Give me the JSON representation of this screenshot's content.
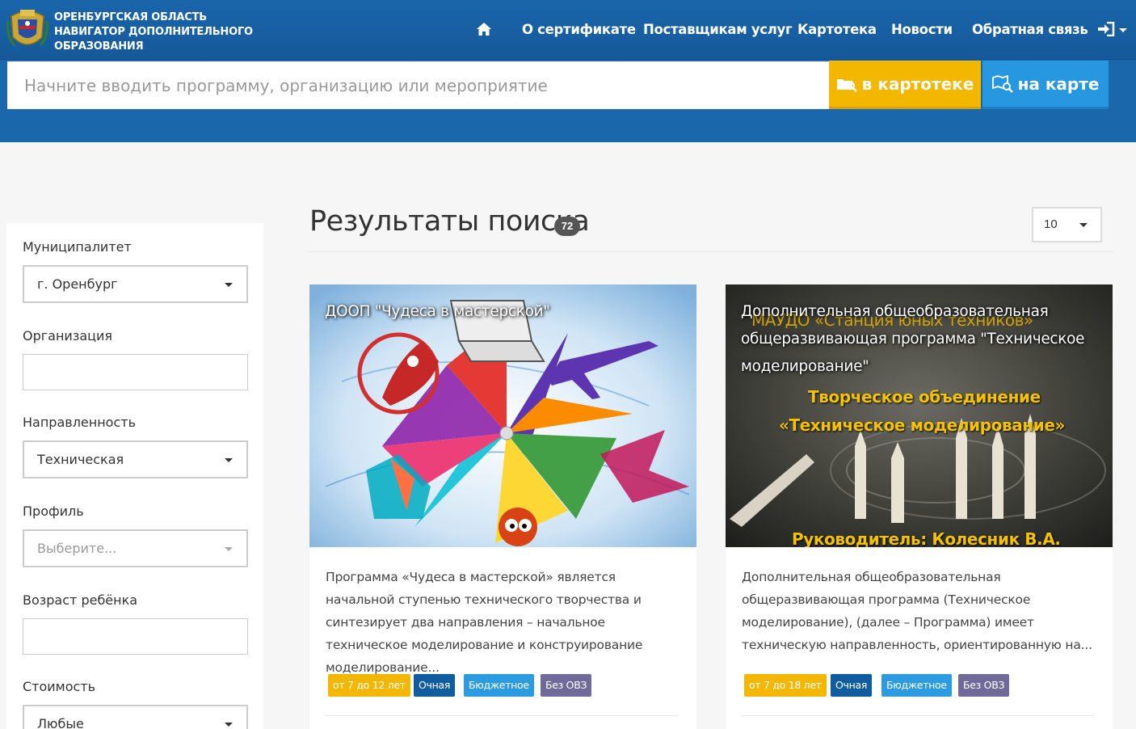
{
  "header": {
    "brand_line1": "Оренбургская область",
    "brand_line2": "Навигатор дополнительного",
    "brand_line3": "образования",
    "nav": [
      {
        "label": "О сертификате"
      },
      {
        "label": "Поставщикам услуг"
      },
      {
        "label": "Картотека"
      },
      {
        "label": "Новости"
      },
      {
        "label": "Обратная связь"
      }
    ],
    "icons": {
      "home": "home-icon",
      "login": "sign-in-icon"
    }
  },
  "search": {
    "placeholder": "Начните вводить программу, организацию или мероприятие",
    "btn_catalog": "в картотеке",
    "btn_map": "на карте"
  },
  "filters": {
    "municipality_label": "Муниципалитет",
    "municipality_value": "г. Оренбург",
    "organization_label": "Организация",
    "organization_value": "",
    "direction_label": "Направленность",
    "direction_value": "Техническая",
    "profile_label": "Профиль",
    "profile_placeholder": "Выберите...",
    "age_label": "Возраст ребёнка",
    "age_value": "",
    "cost_label": "Стоимость",
    "cost_value": "Любые"
  },
  "results": {
    "title": "Результаты поиска",
    "count": "72",
    "per_page": "10"
  },
  "cards": [
    {
      "title": "ДООП \"Чудеса в мастерской\"",
      "description": "Программа «Чудеса в мастерской» является начальной ступенью технического творчества и синтезирует два направления – начальное техническое моделирование и конструирование моделирование...",
      "tags": {
        "age": "от 7 до 12 лет",
        "form": "Очная",
        "funding": "Бюджетное",
        "ovz": "Без ОВЗ"
      }
    },
    {
      "title": "Дополнительная общеобразовательная общеразвивающая программа \"Техническое моделирование\"",
      "image_text_top": "МАУДО «Станция юных техников»",
      "image_text_mid1": "Творческое объединение",
      "image_text_mid2": "«Техническое моделирование»",
      "image_text_bottom": "Руководитель: Колесник В.А.",
      "description": "Дополнительная общеобразовательная общеразвивающая программа (Техническое моделирование), (далее – Программа) имеет техническую направленность, ориентированную на...",
      "tags": {
        "age": "от 7 до 18 лет",
        "form": "Очная",
        "funding": "Бюджетное",
        "ovz": "Без ОВЗ"
      }
    }
  ]
}
